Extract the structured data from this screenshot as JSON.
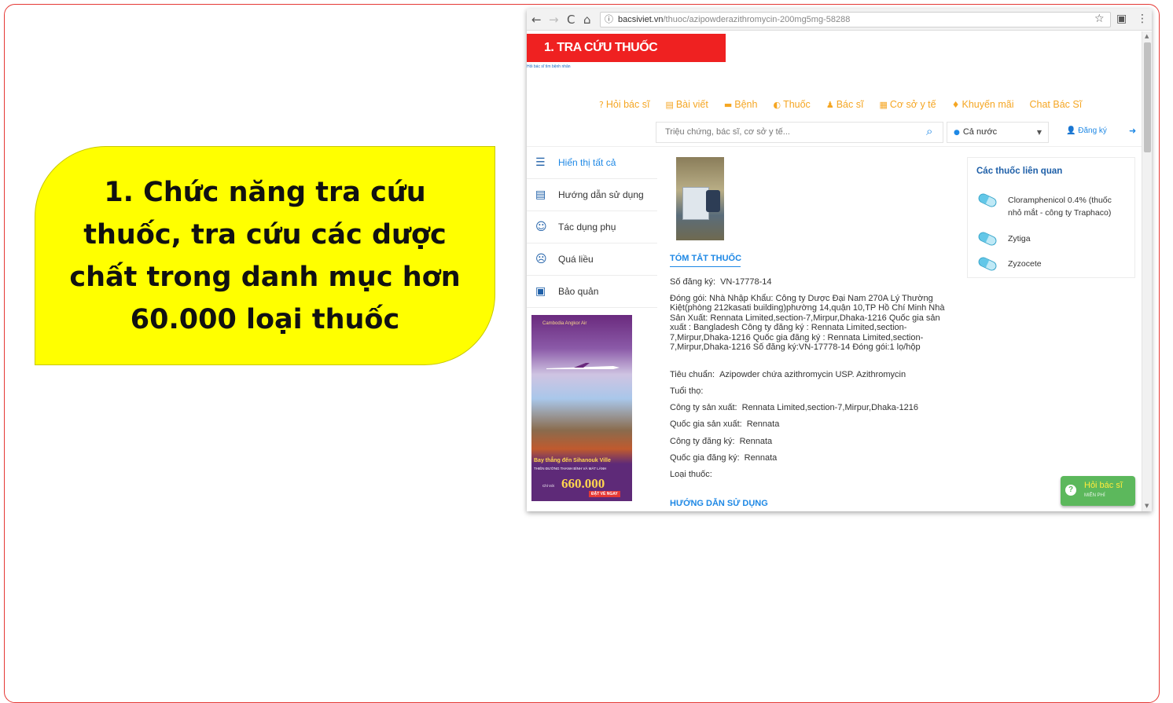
{
  "callout": {
    "text": "1. Chức năng tra cứu thuốc, tra cứu các dược chất trong danh mục hơn 60.000 loại thuốc"
  },
  "browser": {
    "url_domain": "bacsiviet.vn",
    "url_path": "/thuoc/azipowderazithromycin-200mg5mg-58288",
    "back_glyph": "←",
    "forward_glyph": "→",
    "reload_glyph": "C",
    "home_glyph": "⌂",
    "info_glyph": "ⓘ",
    "star_glyph": "☆",
    "ext_glyph": "▣",
    "menu_glyph": "⋮"
  },
  "site": {
    "banner": "1. TRA CỨU THUỐC",
    "tagline": "Hỏi bác sĩ tìm bệnh nhân",
    "nav": [
      {
        "icon": "?",
        "label": "Hỏi bác sĩ"
      },
      {
        "icon": "▤",
        "label": "Bài viết"
      },
      {
        "icon": "▬",
        "label": "Bệnh"
      },
      {
        "icon": "◐",
        "label": "Thuốc"
      },
      {
        "icon": "♟",
        "label": "Bác sĩ"
      },
      {
        "icon": "▦",
        "label": "Cơ sở y tế"
      },
      {
        "icon": "♦",
        "label": "Khuyến mãi"
      },
      {
        "icon": "",
        "label": "Chat Bác Sĩ"
      }
    ],
    "search_placeholder": "Triệu chứng, bác sĩ, cơ sở y tế...",
    "search_icon": "⌕",
    "region": "Cả nước",
    "register": "Đăng ký",
    "login_icon": "➜"
  },
  "sidebar": {
    "items": [
      {
        "icon": "☰",
        "label": "Hiển thị tất cả"
      },
      {
        "icon": "▤",
        "label": "Hướng dẫn sử dụng"
      },
      {
        "icon": "☺",
        "label": "Tác dụng phụ"
      },
      {
        "icon": "☹",
        "label": "Quá liều"
      },
      {
        "icon": "▣",
        "label": "Bảo quản"
      }
    ]
  },
  "ad": {
    "logo": "Cambodia Angkor Air",
    "line1": "Bay thẳng đến Sihanouk Ville",
    "line2": "THIÊN ĐƯỜNG THANH BÌNH VÀ MÁT LÀNH",
    "pre": "Chỉ Với",
    "price": "660.000",
    "cta": "ĐẶT VÉ NGAY"
  },
  "drug": {
    "summary_title": "TÓM TẮT THUỐC",
    "reg_label": "Số đăng ký:",
    "reg_value": "VN-17778-14",
    "pack_label": "Đóng gói:",
    "pack_value": "Nhà Nhập Khẩu: Công ty Dược Đại Nam 270A Lý Thường Kiệt(phòng 212kasati building)phường 14,quận 10,TP Hồ Chí Minh Nhà Sản Xuất: Rennata Limited,section-7,Mirpur,Dhaka-1216 Quốc gia sản xuất : Bangladesh Công ty đăng ký : Rennata Limited,section-7,Mirpur,Dhaka-1216 Quốc gia đăng ký : Rennata Limited,section-7,Mirpur,Dhaka-1216 Số đăng ký:VN-17778-14 Đóng gói:1 lọ/hộp",
    "std_label": "Tiêu chuẩn:",
    "std_value": "Azipowder chứa azithromycin USP. Azithromycin",
    "life_label": "Tuổi thọ:",
    "life_value": "",
    "maker_label": "Công ty sản xuất:",
    "maker_value": "Rennata Limited,section-7,Mirpur,Dhaka-1216",
    "maker_country_label": "Quốc gia sản xuất:",
    "maker_country_value": "Rennata",
    "reg_co_label": "Công ty đăng ký:",
    "reg_co_value": "Rennata",
    "reg_country_label": "Quốc gia đăng ký:",
    "reg_country_value": "Rennata",
    "type_label": "Loại thuốc:",
    "type_value": "",
    "usage_title": "HƯỚNG DẪN SỬ DỤNG"
  },
  "related": {
    "title": "Các thuốc liên quan",
    "items": [
      "Cloramphenicol 0.4% (thuốc nhỏ mắt - công ty Traphaco)",
      "Zytiga",
      "Zyzocete"
    ]
  },
  "ask": {
    "q": "?",
    "line1": "Hỏi bác sĩ",
    "line2": "MIỄN PHÍ"
  },
  "colors": {
    "accent": "#1e88e5",
    "nav": "#f5a623",
    "banner": "#ef2121",
    "callout": "#ffff00"
  }
}
